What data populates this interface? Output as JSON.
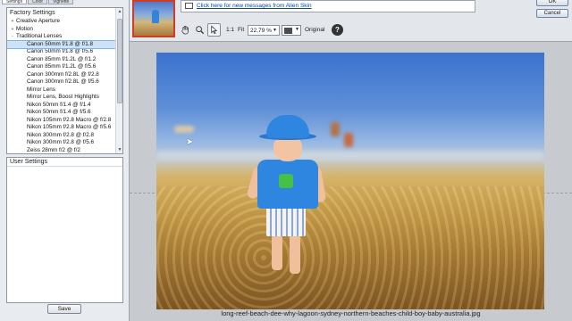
{
  "tabs": [
    "Settings",
    "Color",
    "Vignette"
  ],
  "factory_settings": {
    "header": "Factory Settings",
    "items": [
      {
        "label": "Creative Aperture",
        "level": 1,
        "expander": "+"
      },
      {
        "label": "Motion",
        "level": 1,
        "expander": "+"
      },
      {
        "label": "Traditional Lenses",
        "level": 1,
        "expander": "-"
      },
      {
        "label": "Canon  50mm f/1.8 @ f/1.8",
        "level": 2,
        "selected": true
      },
      {
        "label": "Canon  50mm f/1.8 @ f/5.6",
        "level": 2
      },
      {
        "label": "Canon  85mm f/1.2L @ f/1.2",
        "level": 2
      },
      {
        "label": "Canon  85mm f/1.2L @ f/5.6",
        "level": 2
      },
      {
        "label": "Canon 300mm f/2.8L @ f/2.8",
        "level": 2
      },
      {
        "label": "Canon 300mm f/2.8L @ f/5.6",
        "level": 2
      },
      {
        "label": "Mirror Lens",
        "level": 2
      },
      {
        "label": "Mirror Lens, Boost Highlights",
        "level": 2
      },
      {
        "label": "Nikon  50mm f/1.4 @ f/1.4",
        "level": 2
      },
      {
        "label": "Nikon  50mm f/1.4 @ f/5.6",
        "level": 2
      },
      {
        "label": "Nikon 105mm f/2.8 Macro @ f/2.8",
        "level": 2
      },
      {
        "label": "Nikon 105mm f/2.8 Macro @ f/5.6",
        "level": 2
      },
      {
        "label": "Nikon 300mm f/2.8 @ f/2.8",
        "level": 2
      },
      {
        "label": "Nikon 300mm f/2.8 @ f/5.6",
        "level": 2
      },
      {
        "label": "Zeiss  28mm f/2 @ f/2",
        "level": 2
      }
    ]
  },
  "user_settings": {
    "header": "User Settings"
  },
  "save_label": "Save",
  "message_link": "Click here for new messages from Alien Skin",
  "ok_label": "OK",
  "cancel_label": "Cancel",
  "toolbar": {
    "one_to_one": "1:1",
    "fit": "Fit",
    "zoom_value": "22,79 %",
    "original_label": "Original",
    "icons": [
      "hand-icon",
      "magnifier-icon",
      "arrow-pointer-icon",
      "help-icon"
    ]
  },
  "filename": "long-reef-beach-dee-why-lagoon-sydney-northern-beaches-child-boy-baby-australia.jpg"
}
